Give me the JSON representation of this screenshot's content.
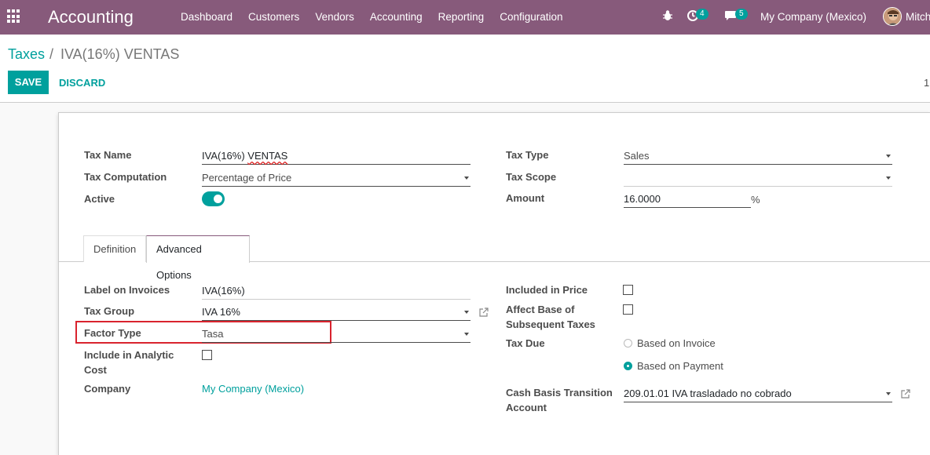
{
  "navbar": {
    "brand": "Accounting",
    "menu": [
      "Dashboard",
      "Customers",
      "Vendors",
      "Accounting",
      "Reporting",
      "Configuration"
    ],
    "activity_count": "4",
    "message_count": "5",
    "company": "My Company (Mexico)",
    "user": "Mitch"
  },
  "breadcrumb": {
    "parent": "Taxes",
    "separator": "/",
    "current": "IVA(16%) VENTAS"
  },
  "buttons": {
    "save": "SAVE",
    "discard": "DISCARD"
  },
  "pager": "1",
  "form": {
    "tax_name_label": "Tax Name",
    "tax_name_value": "IVA(16%)",
    "tax_name_value_suffix": "VENTAS",
    "tax_computation_label": "Tax Computation",
    "tax_computation_value": "Percentage of Price",
    "active_label": "Active",
    "active_value": true,
    "tax_type_label": "Tax Type",
    "tax_type_value": "Sales",
    "tax_scope_label": "Tax Scope",
    "tax_scope_value": "",
    "amount_label": "Amount",
    "amount_value": "16.0000",
    "amount_unit": "%"
  },
  "tabs": [
    {
      "label": "Definition",
      "active": false
    },
    {
      "label": "Advanced Options",
      "active": true
    }
  ],
  "advanced": {
    "label_on_invoices_label": "Label on Invoices",
    "label_on_invoices_value": "IVA(16%)",
    "tax_group_label": "Tax Group",
    "tax_group_value": "IVA 16%",
    "factor_type_label": "Factor Type",
    "factor_type_value": "Tasa",
    "include_analytic_label_1": "Include in Analytic",
    "include_analytic_label_2": "Cost",
    "include_analytic_value": false,
    "company_label": "Company",
    "company_value": "My Company (Mexico)",
    "included_in_price_label": "Included in Price",
    "included_in_price_value": false,
    "affect_base_label_1": "Affect Base of",
    "affect_base_label_2": "Subsequent Taxes",
    "affect_base_value": false,
    "tax_due_label": "Tax Due",
    "tax_due_options": [
      "Based on Invoice",
      "Based on Payment"
    ],
    "tax_due_selected": "Based on Payment",
    "cash_basis_label_1": "Cash Basis Transition",
    "cash_basis_label_2": "Account",
    "cash_basis_value": "209.01.01 IVA trasladado no cobrado"
  },
  "colors": {
    "navbar": "#875a7b",
    "primary": "#00a09d",
    "highlight": "#d9232e"
  }
}
